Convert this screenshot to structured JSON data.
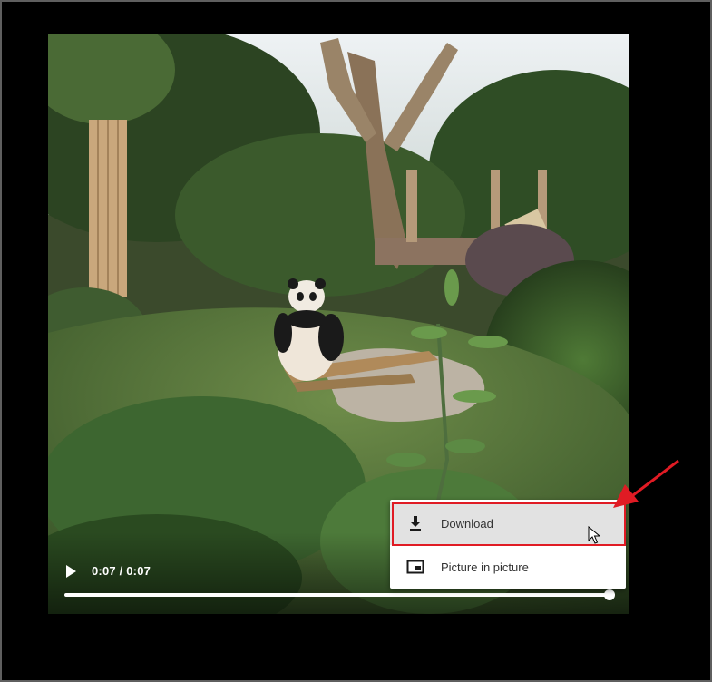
{
  "player": {
    "time_display": "0:07 / 0:07",
    "progress_fraction": 1.0
  },
  "context_menu": {
    "items": [
      {
        "label": "Download",
        "icon": "download-icon",
        "highlighted": true
      },
      {
        "label": "Picture in picture",
        "icon": "picture-in-picture-icon",
        "highlighted": false
      }
    ]
  },
  "annotation": {
    "highlight_color": "#e01b24",
    "arrow_color": "#e01b24"
  }
}
